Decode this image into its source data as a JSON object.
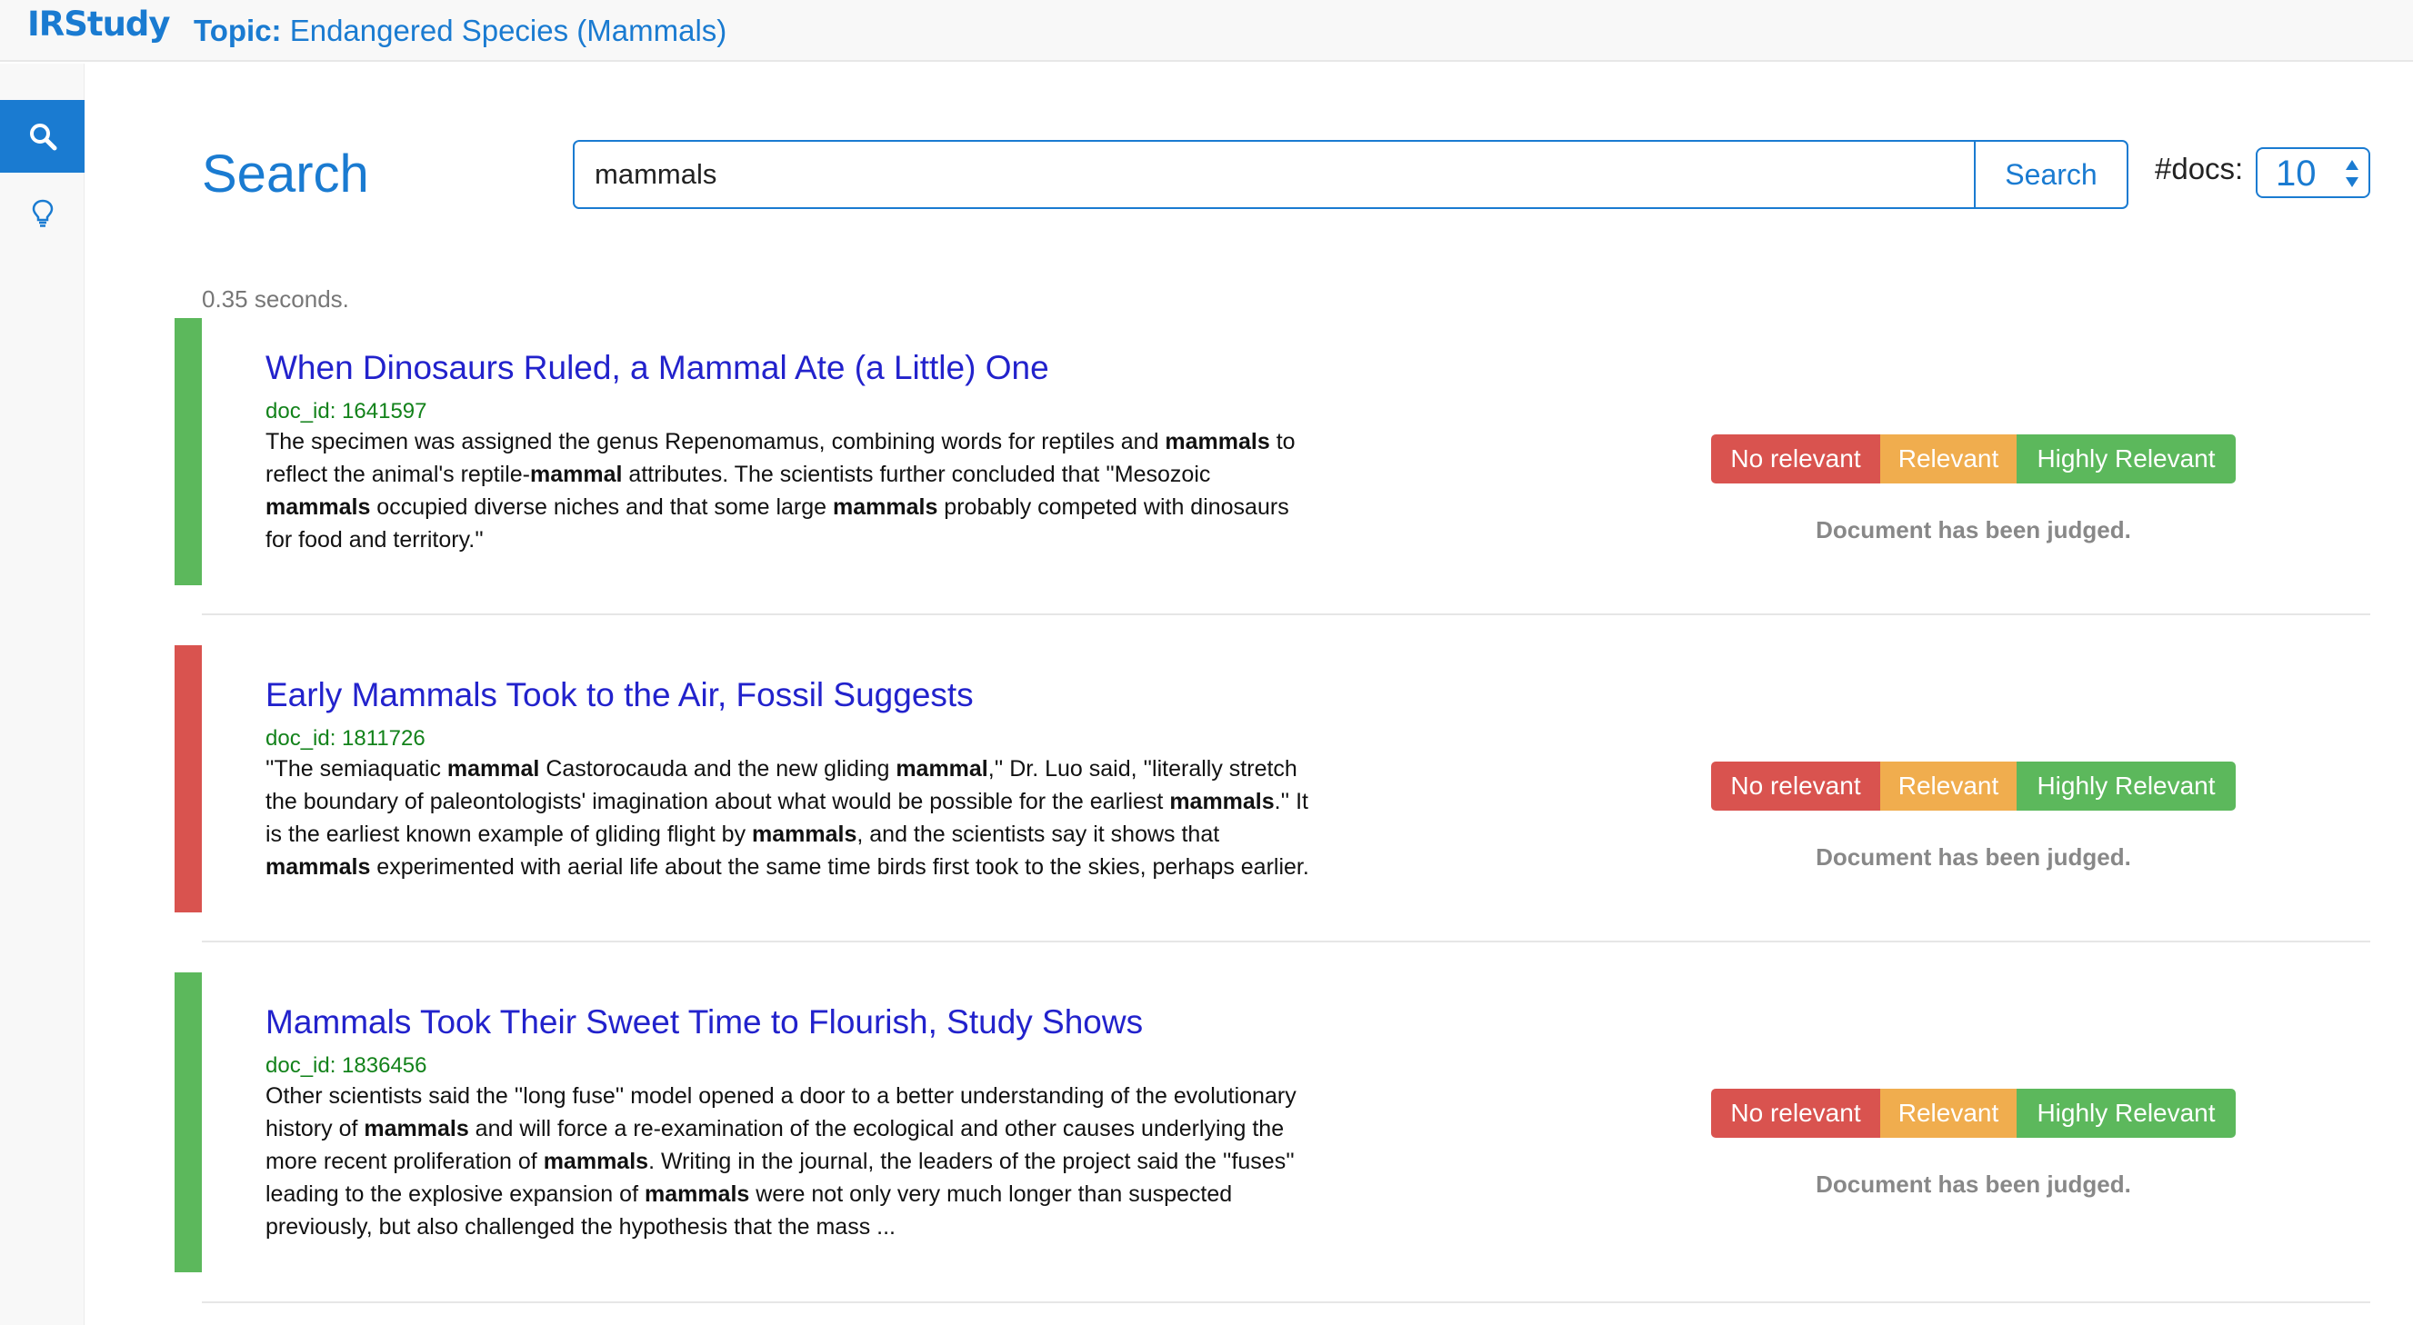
{
  "app": {
    "brand": "IRStudy",
    "topic_label": "Topic:",
    "topic_value": "Endangered Species (Mammals)"
  },
  "sidebar": {
    "items": [
      {
        "icon": "search-icon",
        "active": true
      },
      {
        "icon": "lightbulb-icon",
        "active": false
      }
    ]
  },
  "search": {
    "title": "Search",
    "query": "mammals",
    "button_label": "Search",
    "docs_label": "#docs:",
    "docs_value": "10",
    "timing": "0.35 seconds."
  },
  "judgement": {
    "no_label": "No relevant",
    "rel_label": "Relevant",
    "high_label": "Highly Relevant",
    "judged_text": "Document has been judged."
  },
  "colors": {
    "accent": "#1a7bd1",
    "title_link": "#2222cc",
    "doc_id": "#12821a",
    "judged_relevant": "#5cb85c",
    "judged_not_relevant": "#d9534f",
    "no_relevant": "#d9534f",
    "relevant": "#f0ad4e",
    "highly_relevant": "#5cb85c"
  },
  "results": [
    {
      "title": "When Dinosaurs Ruled, a Mammal Ate (a Little) One",
      "doc_id": "doc_id: 1641597",
      "judged_status": "relevant",
      "snippet": [
        {
          "t": "The specimen was assigned the genus Repenomamus, combining words for reptiles and "
        },
        {
          "t": "mammals",
          "b": true
        },
        {
          "t": " to reflect the animal's reptile-"
        },
        {
          "t": "mammal",
          "b": true
        },
        {
          "t": " attributes. The scientists further concluded that ''Mesozoic "
        },
        {
          "t": "mammals",
          "b": true
        },
        {
          "t": " occupied diverse niches and that some large "
        },
        {
          "t": "mammals",
          "b": true
        },
        {
          "t": " probably competed with dinosaurs for food and territory.''"
        }
      ]
    },
    {
      "title": "Early Mammals Took to the Air, Fossil Suggests",
      "doc_id": "doc_id: 1811726",
      "judged_status": "not_relevant",
      "snippet": [
        {
          "t": "''The semiaquatic "
        },
        {
          "t": "mammal",
          "b": true
        },
        {
          "t": " Castorocauda and the new gliding "
        },
        {
          "t": "mammal",
          "b": true
        },
        {
          "t": ",'' Dr. Luo said, ''literally stretch the boundary of paleontologists' imagination about what would be possible for the earliest "
        },
        {
          "t": "mammals",
          "b": true
        },
        {
          "t": ".'' It is the earliest known example of gliding flight by "
        },
        {
          "t": "mammals",
          "b": true
        },
        {
          "t": ", and the scientists say it shows that "
        },
        {
          "t": "mammals",
          "b": true
        },
        {
          "t": " experimented with aerial life about the same time birds first took to the skies, perhaps earlier."
        }
      ]
    },
    {
      "title": "Mammals Took Their Sweet Time to Flourish, Study Shows",
      "doc_id": "doc_id: 1836456",
      "judged_status": "relevant",
      "snippet": [
        {
          "t": "Other scientists said the ''long fuse'' model opened a door to a better understanding of the evolutionary history of "
        },
        {
          "t": "mammals",
          "b": true
        },
        {
          "t": " and will force a re-examination of the ecological and other causes underlying the more recent proliferation of "
        },
        {
          "t": "mammals",
          "b": true
        },
        {
          "t": ". Writing in the journal, the leaders of the project said the ''fuses'' leading to the explosive expansion of "
        },
        {
          "t": "mammals",
          "b": true
        },
        {
          "t": " were not only very much longer than suspected previously, but also challenged the hypothesis that the mass ..."
        }
      ]
    }
  ]
}
